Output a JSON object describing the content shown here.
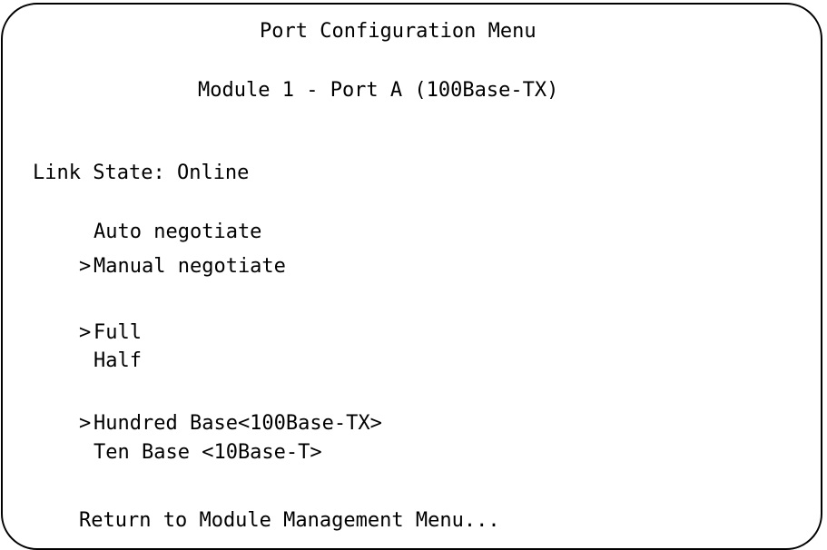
{
  "menu": {
    "title": "Port Configuration Menu",
    "subtitle": "Module 1 - Port A (100Base-TX)",
    "link_state_label": "Link State:",
    "link_state_value": "Online",
    "selection_marker": ">",
    "negotiation_options": [
      {
        "label": "Auto negotiate",
        "selected": false
      },
      {
        "label": "Manual negotiate",
        "selected": true
      }
    ],
    "duplex_options": [
      {
        "label": "Full",
        "selected": true
      },
      {
        "label": "Half",
        "selected": false
      }
    ],
    "speed_options": [
      {
        "label": "Hundred Base<100Base-TX>",
        "selected": true
      },
      {
        "label": "Ten Base <10Base-T>",
        "selected": false
      }
    ],
    "return_label": "Return to Module Management Menu..."
  }
}
